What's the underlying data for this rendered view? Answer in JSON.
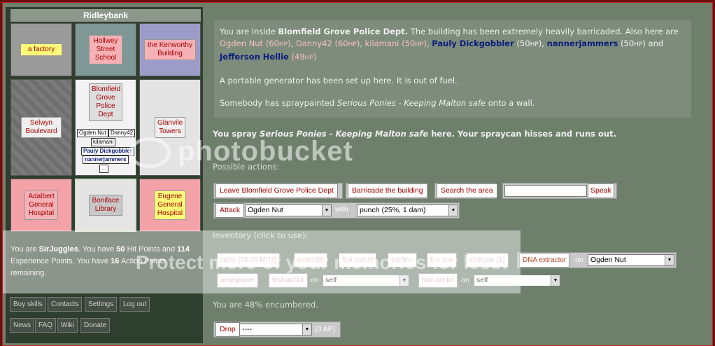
{
  "map": {
    "title": "Ridleybank",
    "cells": [
      {
        "label": "a factory"
      },
      {
        "label": "Hollwey Street School"
      },
      {
        "label": "the Kenworthy Building"
      },
      {
        "label": "Selwyn Boulevard"
      },
      {
        "label": "Blomfield Grove Police Dept"
      },
      {
        "label": "Glanvile Towers"
      },
      {
        "label": "Adalbert General Hospital"
      },
      {
        "label": "Boniface Library"
      },
      {
        "label": "Eugene General Hospital"
      }
    ],
    "occupants": [
      "Ogden Nut",
      "Danny42",
      "kilamani",
      "Pauly Dickgobbler",
      "nannerjammers",
      "..."
    ]
  },
  "status": {
    "prefix": "You are",
    "name": "SirJuggles",
    "mid1": ". You have",
    "hp": "50",
    "mid2": "Hit Points and",
    "xp": "114",
    "mid3": "Experience Points. You have",
    "ap": "16",
    "suffix": "Action Points remaining."
  },
  "nav": {
    "buy_skills": "Buy skills",
    "contacts": "Contacts",
    "settings": "Settings",
    "log_out": "Log out",
    "news": "News",
    "faq": "FAQ",
    "wiki": "Wiki",
    "donate": "Donate"
  },
  "description": {
    "intro": "You are inside",
    "building": "Blomfield Grove Police Dept.",
    "barricade": "The building has been extremely heavily barricaded. Also here are",
    "people": [
      {
        "name": "Ogden Nut",
        "hp": "60",
        "color": "red"
      },
      {
        "name": "Danny42",
        "hp": "60",
        "color": "red"
      },
      {
        "name": "kilamani",
        "hp": "50",
        "color": "red"
      },
      {
        "name": "Pauly Dickgobbler",
        "hp": "50",
        "color": "blue"
      },
      {
        "name": "nannerjammers",
        "hp": "50",
        "color": "blue"
      },
      {
        "name": "Jefferson Hellie",
        "hp": "49",
        "color": "blue"
      }
    ],
    "hp_unit": "HP",
    "and": "and",
    "generator": "A portable generator has been set up here. It is out of fuel.",
    "graffiti_pre": "Somebody has spraypainted",
    "graffiti_text": "Serious Ponies - Keeping Malton safe",
    "graffiti_post": "onto a wall."
  },
  "spray_msg": {
    "pre": "You spray",
    "text": "Serious Ponies - Keeping Malton safe",
    "post": "here. Your spraycan hisses and runs out."
  },
  "actions": {
    "heading": "Possible actions:",
    "leave": "Leave Blomfield Grove Police Dept",
    "barricade": "Barricade the building",
    "search": "Search the area",
    "speak": "Speak",
    "speak_value": "",
    "attack": "Attack",
    "attack_target": "Ogden Nut",
    "with": "with",
    "weapon": "punch (25%, 1 dam)"
  },
  "inventory": {
    "heading": "Inventory (click to use):",
    "items": [
      "radio (26.00 MHz)",
      "pistol (0)",
      "flak jacket",
      "toolbox",
      "fire axe",
      "shotgun (1)"
    ],
    "dna": "DNA extractor",
    "on": "on",
    "dna_target": "Ogden Nut",
    "newspaper": "newspaper",
    "first_aid": "first-aid kit",
    "first_aid_target": "self",
    "encumbered": "You are 48% encumbered.",
    "drop": "Drop",
    "drop_value": "----",
    "drop_cost": "(0 AP)"
  },
  "watermark": {
    "brand": "photobucket",
    "tagline": "Protect more of your memories for less!"
  },
  "colors": {
    "background": "#6e7f6c",
    "frame": "#6b0f0f",
    "button_text": "#aa0000"
  }
}
